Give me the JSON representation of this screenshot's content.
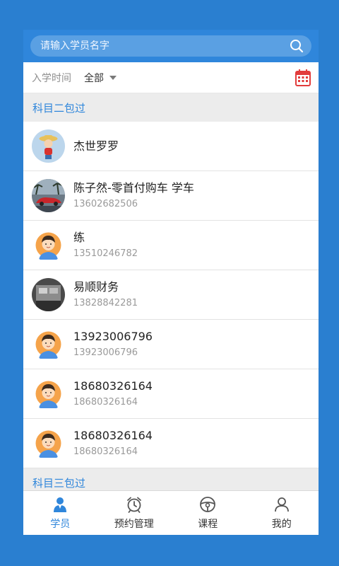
{
  "search": {
    "placeholder": "请输入学员名字"
  },
  "filter": {
    "label": "入学时间",
    "selected": "全部"
  },
  "sections": [
    {
      "title": "科目二包过"
    },
    {
      "title": "科目三包过"
    }
  ],
  "students": [
    {
      "name": "杰世罗罗",
      "phone": "",
      "avatar": "cartoon-avatar"
    },
    {
      "name": "陈子然-零首付购车 学车",
      "phone": "13602682506",
      "avatar": "car-photo-avatar"
    },
    {
      "name": "练",
      "phone": "13510246782",
      "avatar": "default-boy-avatar"
    },
    {
      "name": "易顺财务",
      "phone": "13828842281",
      "avatar": "office-photo-avatar"
    },
    {
      "name": "13923006796",
      "phone": "13923006796",
      "avatar": "default-boy-avatar"
    },
    {
      "name": "18680326164",
      "phone": "18680326164",
      "avatar": "default-boy-avatar"
    },
    {
      "name": "18680326164",
      "phone": "18680326164",
      "avatar": "default-boy-avatar"
    }
  ],
  "nav": [
    {
      "label": "学员",
      "icon": "student-icon",
      "active": true
    },
    {
      "label": "预约管理",
      "icon": "alarm-clock-icon",
      "active": false
    },
    {
      "label": "课程",
      "icon": "steering-wheel-icon",
      "active": false
    },
    {
      "label": "我的",
      "icon": "person-icon",
      "active": false
    }
  ],
  "colors": {
    "accent": "#2f86db",
    "background": "#2a7fd0",
    "calendar": "#e23c3c"
  }
}
